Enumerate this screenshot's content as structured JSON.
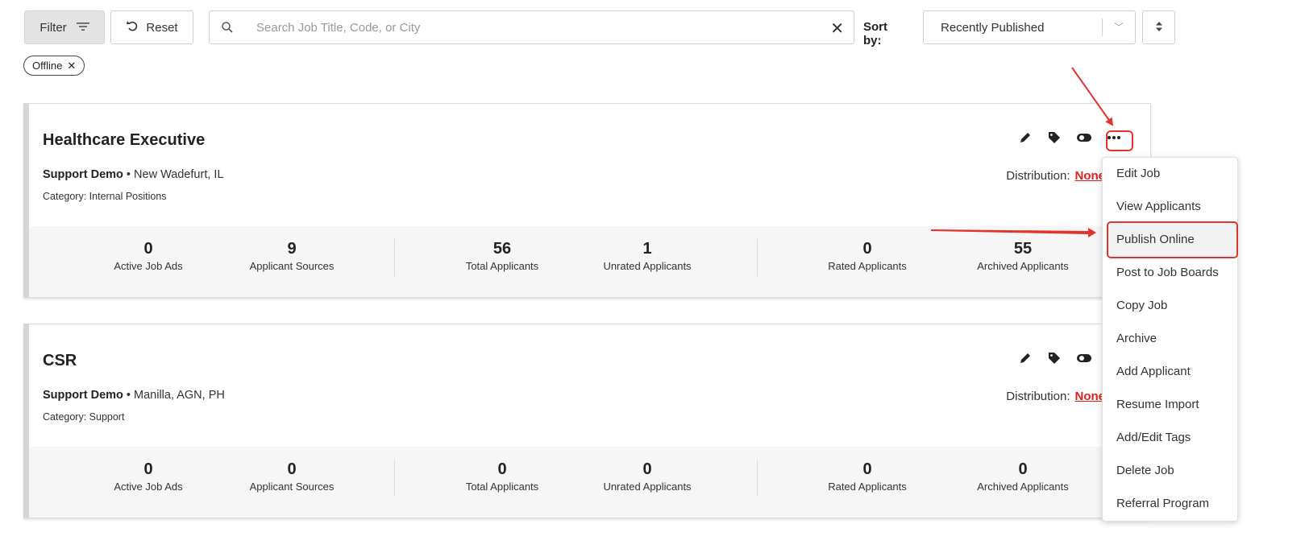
{
  "toolbar": {
    "filter_label": "Filter",
    "reset_label": "Reset",
    "search_placeholder": "Search Job Title, Code, or City",
    "sort_label": "Sort by:",
    "sort_value": "Recently Published"
  },
  "filter_chips": [
    {
      "label": "Offline"
    }
  ],
  "jobs": [
    {
      "title": "Healthcare Executive",
      "company": "Support Demo",
      "location": "New Wadefurt, IL",
      "category": "Category: Internal Positions",
      "distribution_label": "Distribution:",
      "distribution_value": "None",
      "stats": [
        {
          "value": "0",
          "label": "Active Job Ads"
        },
        {
          "value": "9",
          "label": "Applicant Sources"
        },
        {
          "value": "56",
          "label": "Total Applicants"
        },
        {
          "value": "1",
          "label": "Unrated Applicants"
        },
        {
          "value": "0",
          "label": "Rated Applicants"
        },
        {
          "value": "55",
          "label": "Archived Applicants"
        }
      ]
    },
    {
      "title": "CSR",
      "company": "Support Demo",
      "location": "Manilla, AGN, PH",
      "category": "Category: Support",
      "distribution_label": "Distribution:",
      "distribution_value": "None",
      "stats": [
        {
          "value": "0",
          "label": "Active Job Ads"
        },
        {
          "value": "0",
          "label": "Applicant Sources"
        },
        {
          "value": "0",
          "label": "Total Applicants"
        },
        {
          "value": "0",
          "label": "Unrated Applicants"
        },
        {
          "value": "0",
          "label": "Rated Applicants"
        },
        {
          "value": "0",
          "label": "Archived Applicants"
        }
      ]
    }
  ],
  "action_menu": {
    "items": [
      "Edit Job",
      "View Applicants",
      "Publish Online",
      "Post to Job Boards",
      "Copy Job",
      "Archive",
      "Add Applicant",
      "Resume Import",
      "Add/Edit Tags",
      "Delete Job",
      "Referral Program"
    ],
    "highlighted_item": "Publish Online"
  },
  "colors": {
    "accent_red": "#e0352b",
    "distribution_none": "#e0201d"
  },
  "icons": [
    "filter-icon",
    "reset-icon",
    "search-icon",
    "clear-icon",
    "chevron-down-icon",
    "sort-order-icon",
    "pencil-icon",
    "tag-icon",
    "toggle-icon",
    "more-dots-icon"
  ]
}
